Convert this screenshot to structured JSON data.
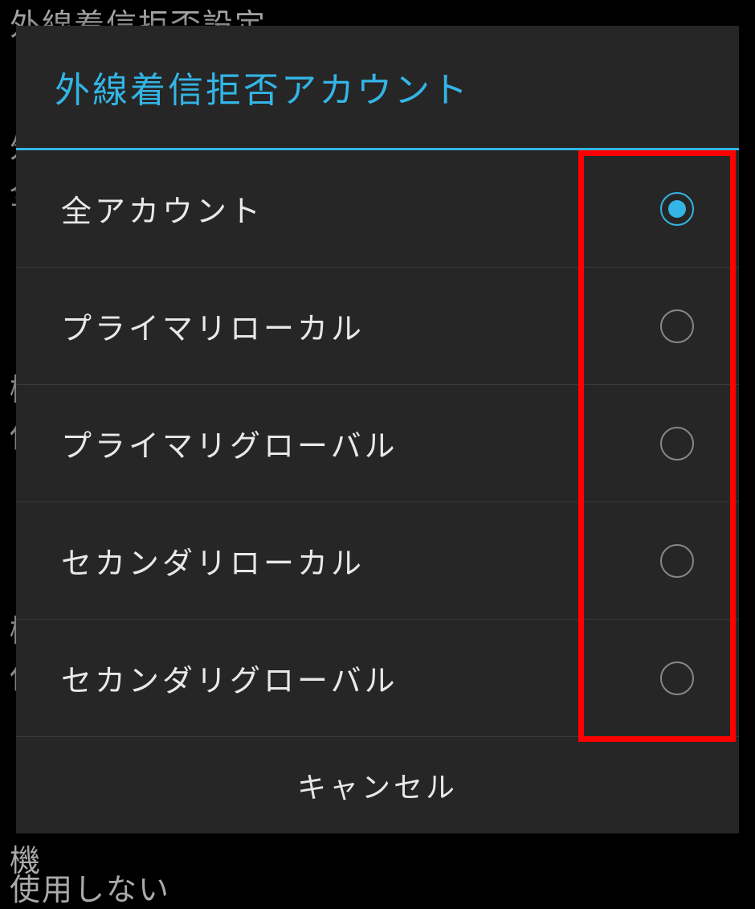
{
  "background": {
    "top_text": "外線着信拒否設定",
    "left_text_1": "外",
    "left_text_2": "全",
    "left_text_3": "機",
    "left_text_4": "使",
    "left_text_5": "機",
    "left_text_6": "使",
    "left_text_7": "機",
    "bottom_text": "使用しない"
  },
  "dialog": {
    "title": "外線着信拒否アカウント",
    "options": [
      {
        "label": "全アカウント",
        "selected": true
      },
      {
        "label": "プライマリローカル",
        "selected": false
      },
      {
        "label": "プライマリグローバル",
        "selected": false
      },
      {
        "label": "セカンダリローカル",
        "selected": false
      },
      {
        "label": "セカンダリグローバル",
        "selected": false
      }
    ],
    "cancel_label": "キャンセル"
  },
  "colors": {
    "accent": "#33b5e5",
    "highlight_box": "#ff0000"
  }
}
